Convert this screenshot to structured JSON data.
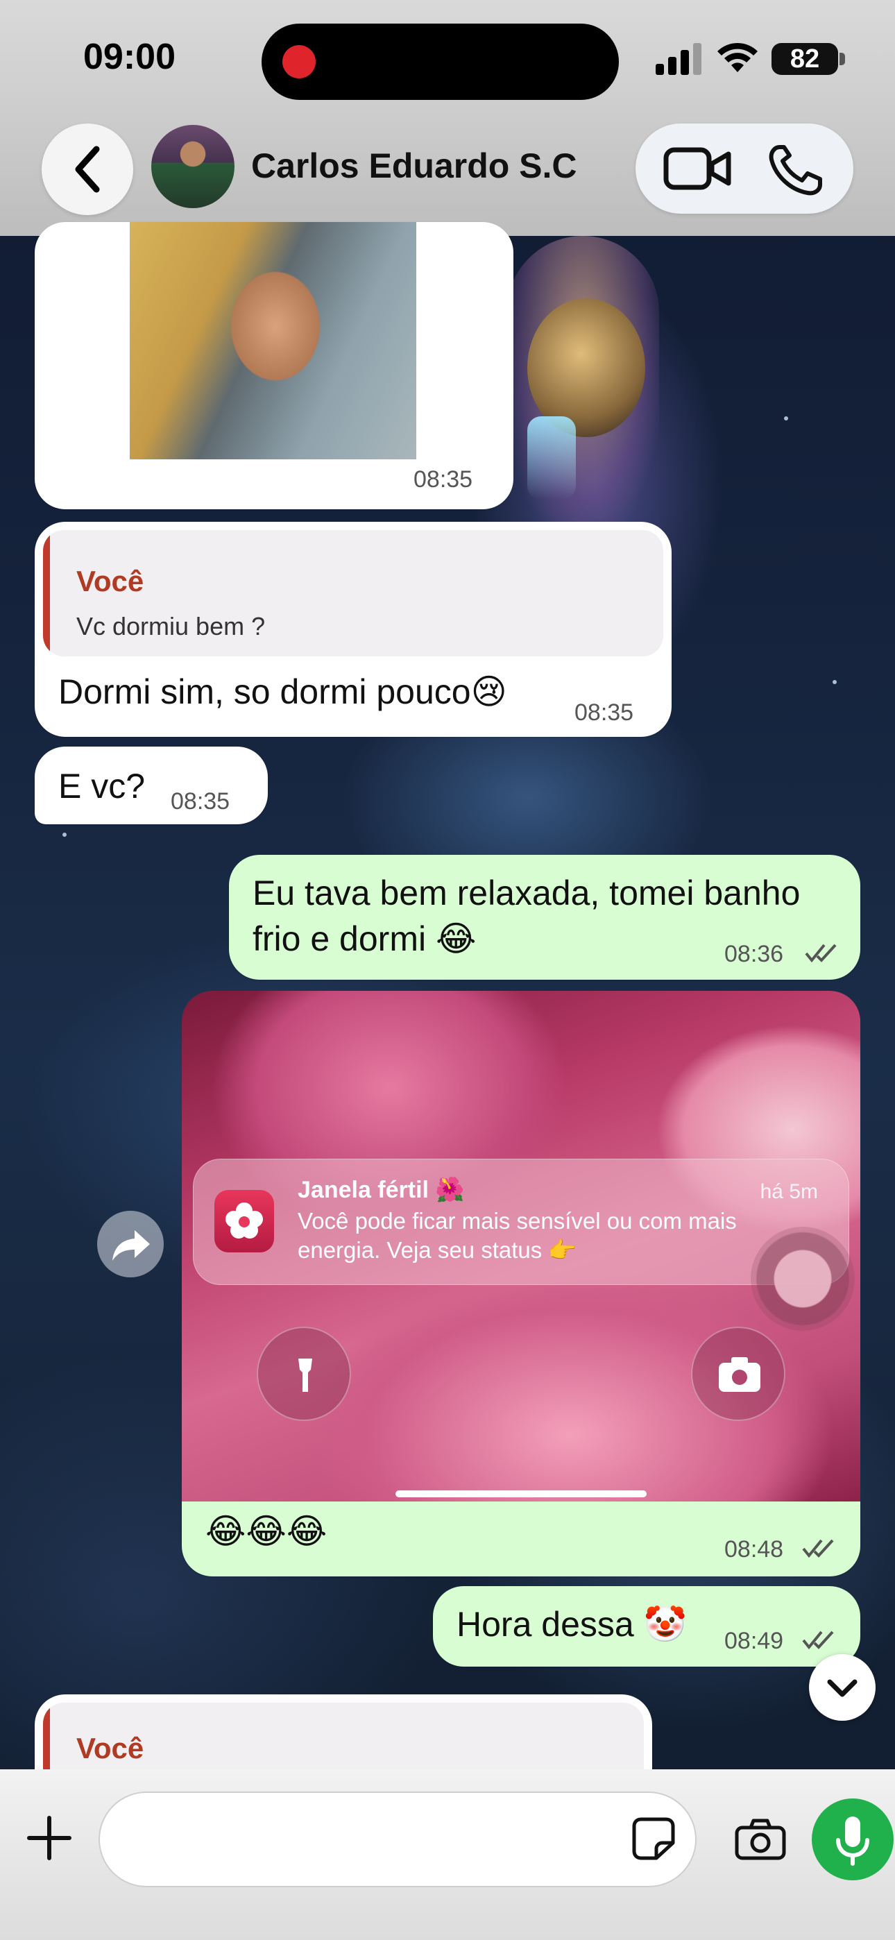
{
  "status_bar": {
    "time": "09:00",
    "battery": "82"
  },
  "header": {
    "contact_name": "Carlos Eduardo S.C"
  },
  "messages": [
    {
      "kind": "image",
      "direction": "incoming",
      "time": "08:35"
    },
    {
      "kind": "reply",
      "direction": "incoming",
      "quote_author": "Você",
      "quote_text": "Vc dormiu bem ?",
      "text": "Dormi sim, so dormi pouco😢",
      "time": "08:35"
    },
    {
      "kind": "text",
      "direction": "incoming",
      "text": "E vc?",
      "time": "08:35"
    },
    {
      "kind": "text",
      "direction": "outgoing",
      "text_line1": "Eu tava bem relaxada, tomei banho",
      "text_line2": "frio e dormi 😂",
      "time": "08:36",
      "status": "read"
    },
    {
      "kind": "image",
      "direction": "outgoing",
      "notification": {
        "title": "Janela fértil 🌺",
        "ago": "há 5m",
        "body": "Você pode ficar mais sensível ou com mais energia. Veja seu status 👉"
      },
      "caption": "😂😂😂",
      "time": "08:48",
      "status": "read"
    },
    {
      "kind": "text",
      "direction": "outgoing",
      "text": "Hora dessa 🤡",
      "time": "08:49",
      "status": "read"
    },
    {
      "kind": "reply-partial",
      "direction": "incoming",
      "quote_author": "Você"
    }
  ],
  "composer": {
    "placeholder": ""
  },
  "icons": {
    "back": "chevron-left-icon",
    "video": "video-camera-icon",
    "phone": "phone-icon",
    "forward": "forward-arrow-icon",
    "scroll_down": "chevron-down-icon",
    "plus": "plus-icon",
    "sticker": "sticker-icon",
    "camera": "camera-icon",
    "mic": "microphone-icon"
  },
  "colors": {
    "outgoing_bubble": "#d9fdd3",
    "incoming_bubble": "#ffffff",
    "quote_accent": "#c0392b",
    "mic_button": "#20b14c"
  }
}
